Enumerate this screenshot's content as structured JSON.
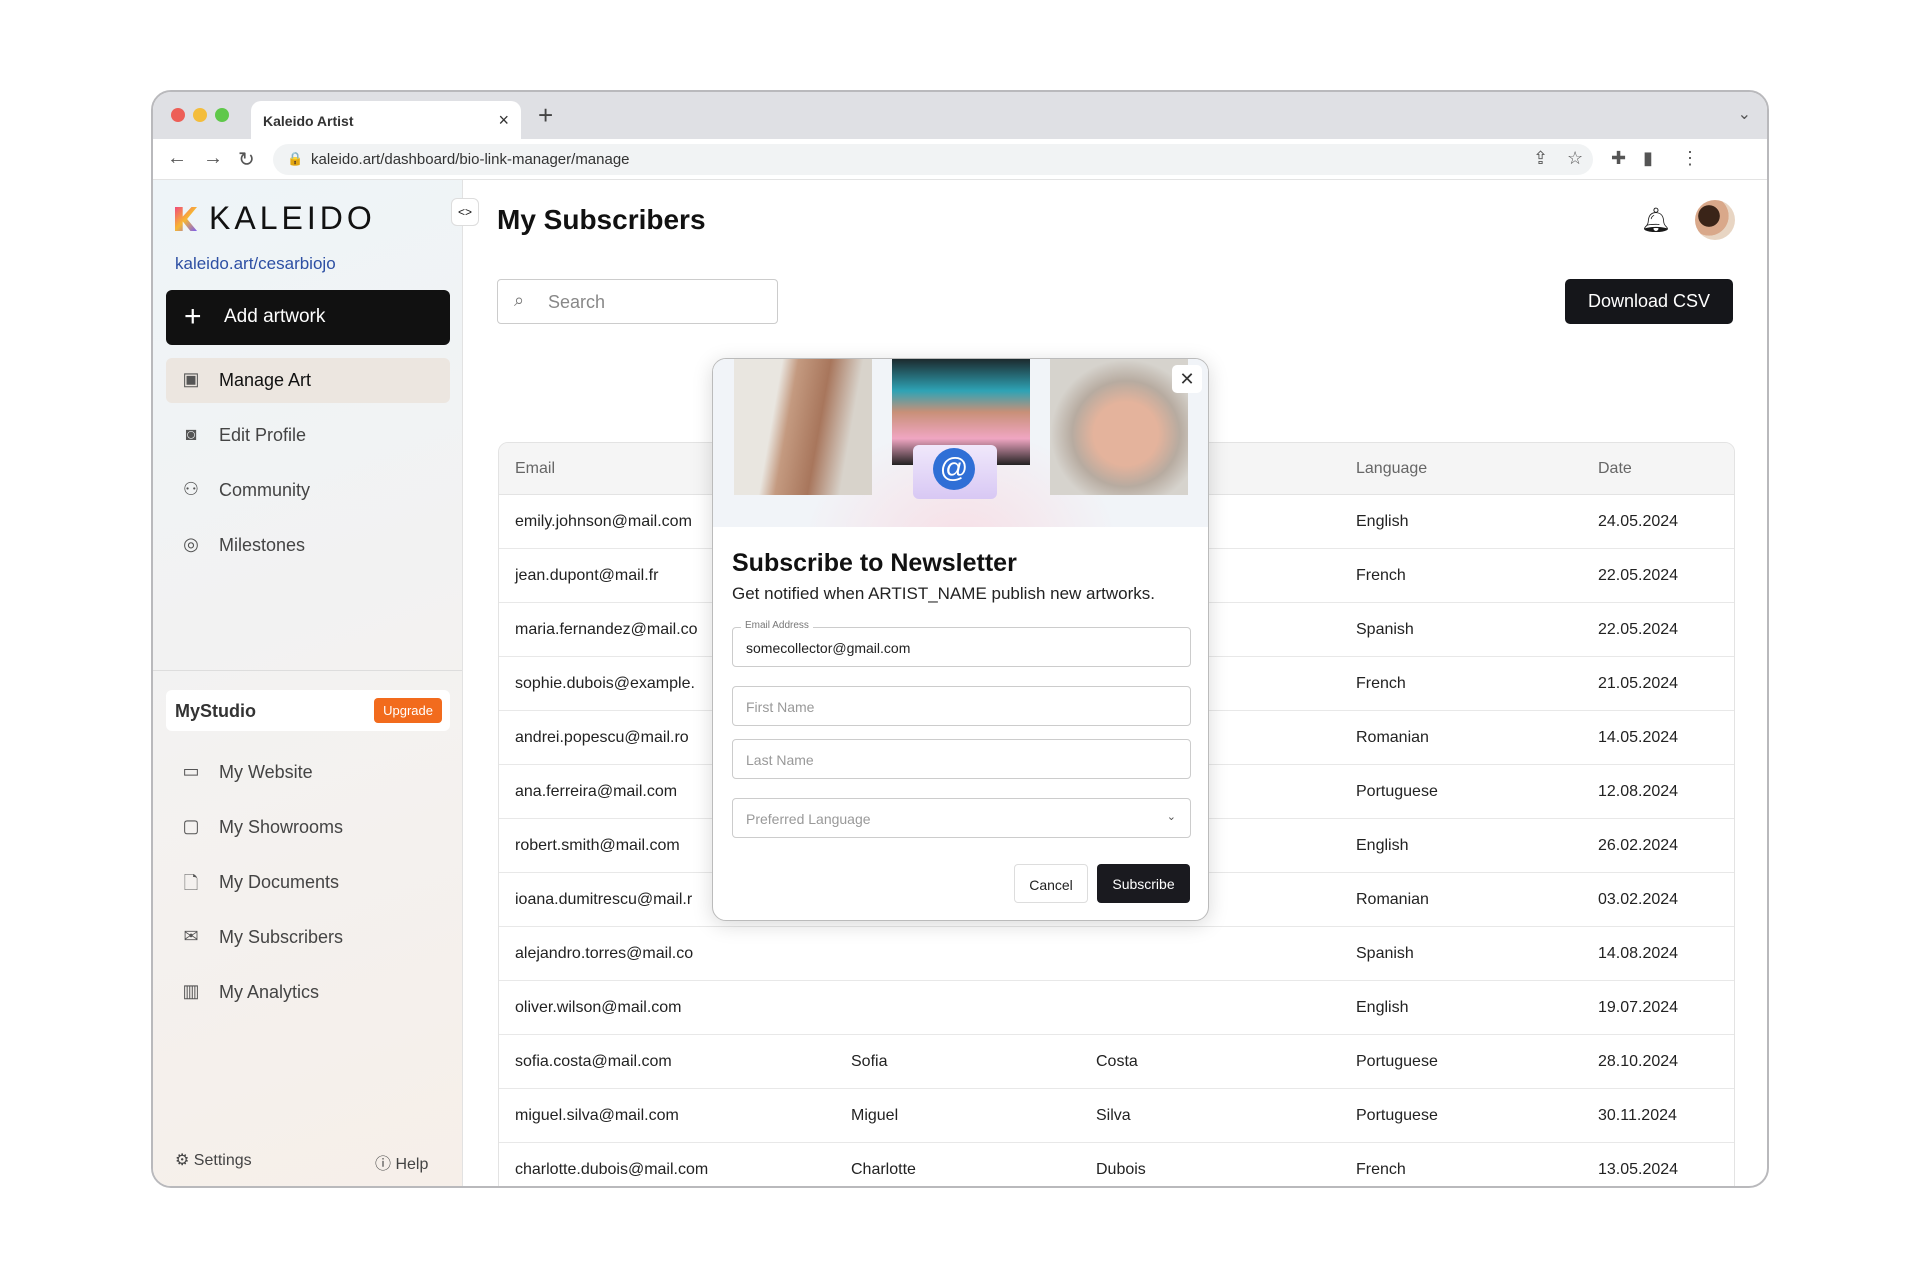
{
  "browser": {
    "tab_title": "Kaleido Artist",
    "url": "kaleido.art/dashboard/bio-link-manager/manage"
  },
  "sidebar": {
    "logo": "KALEIDO",
    "profile_link": "kaleido.art/cesarbiojo",
    "add_artwork": "Add artwork",
    "items": [
      {
        "label": "Manage Art",
        "icon": "image-icon",
        "active": true
      },
      {
        "label": "Edit Profile",
        "icon": "profile-icon"
      },
      {
        "label": "Community",
        "icon": "community-icon"
      },
      {
        "label": "Milestones",
        "icon": "milestones-icon"
      }
    ],
    "studio": {
      "label": "MyStudio",
      "upgrade": "Upgrade"
    },
    "studio_items": [
      {
        "label": "My Website",
        "icon": "website-icon"
      },
      {
        "label": "My Showrooms",
        "icon": "showrooms-icon"
      },
      {
        "label": "My Documents",
        "icon": "document-icon"
      },
      {
        "label": "My Subscribers",
        "icon": "mail-icon"
      },
      {
        "label": "My Analytics",
        "icon": "analytics-icon"
      }
    ],
    "settings": "Settings",
    "help": "Help"
  },
  "header": {
    "title": "My Subscribers"
  },
  "toolbar": {
    "search_placeholder": "Search",
    "download_csv": "Download CSV"
  },
  "table": {
    "columns": [
      "Email",
      "",
      "",
      "Language",
      "Date"
    ],
    "rows": [
      [
        "emily.johnson@mail.com",
        "",
        "",
        "English",
        "24.05.2024"
      ],
      [
        "jean.dupont@mail.fr",
        "",
        "",
        "French",
        "22.05.2024"
      ],
      [
        "maria.fernandez@mail.co",
        "",
        "",
        "Spanish",
        "22.05.2024"
      ],
      [
        "sophie.dubois@example.",
        "",
        "",
        "French",
        "21.05.2024"
      ],
      [
        "andrei.popescu@mail.ro",
        "",
        "",
        "Romanian",
        "14.05.2024"
      ],
      [
        "ana.ferreira@mail.com",
        "",
        "",
        "Portuguese",
        "12.08.2024"
      ],
      [
        "robert.smith@mail.com",
        "",
        "",
        "English",
        "26.02.2024"
      ],
      [
        "ioana.dumitrescu@mail.r",
        "",
        "",
        "Romanian",
        "03.02.2024"
      ],
      [
        "alejandro.torres@mail.co",
        "",
        "",
        "Spanish",
        "14.08.2024"
      ],
      [
        "oliver.wilson@mail.com",
        "",
        "",
        "English",
        "19.07.2024"
      ],
      [
        "sofia.costa@mail.com",
        "Sofia",
        "Costa",
        "Portuguese",
        "28.10.2024"
      ],
      [
        "miguel.silva@mail.com",
        "Miguel",
        "Silva",
        "Portuguese",
        "30.11.2024"
      ],
      [
        "charlotte.dubois@mail.com",
        "Charlotte",
        "Dubois",
        "French",
        "13.05.2024"
      ]
    ]
  },
  "modal": {
    "title": "Subscribe to Newsletter",
    "subtitle": "Get notified when ARTIST_NAME publish new artworks.",
    "email_label": "Email Address",
    "email_value": "somecollector@gmail.com",
    "first_name_placeholder": "First Name",
    "last_name_placeholder": "Last Name",
    "language_placeholder": "Preferred Language",
    "cancel": "Cancel",
    "subscribe": "Subscribe"
  },
  "colors": {
    "accent": "#15161a",
    "upgrade": "#f26b1d",
    "link": "#2d4fa3"
  }
}
